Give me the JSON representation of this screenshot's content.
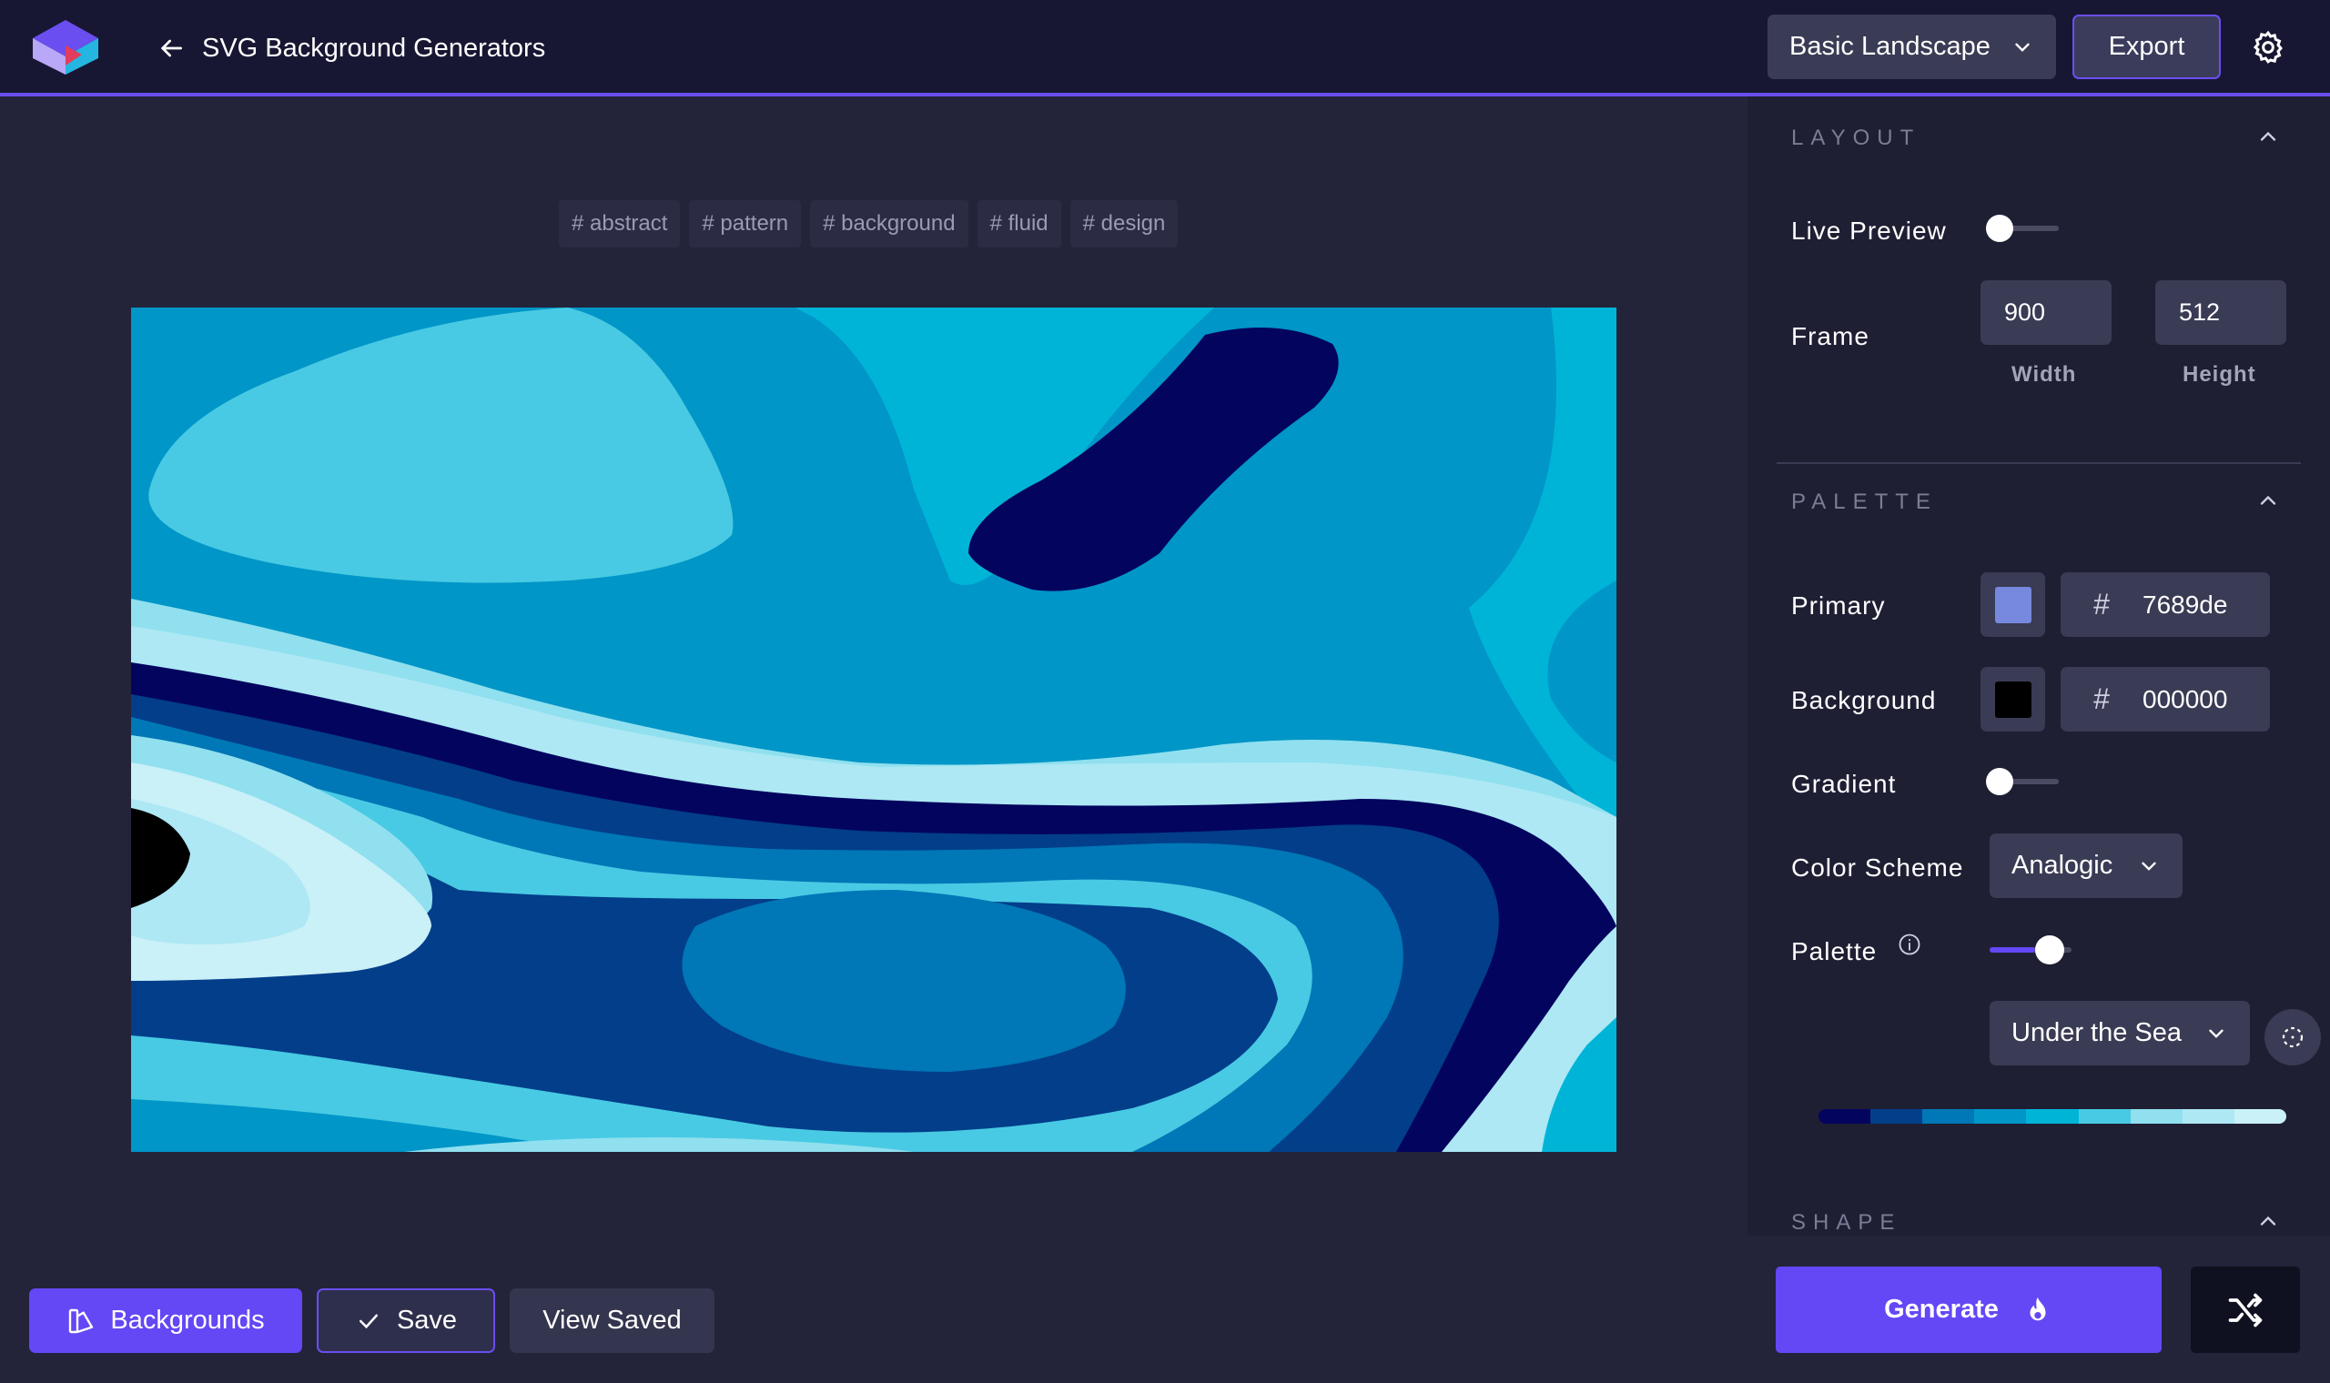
{
  "header": {
    "back_label": "SVG Background Generators",
    "preset": "Basic Landscape",
    "export_label": "Export"
  },
  "tags": [
    "# abstract",
    "# pattern",
    "# background",
    "# fluid",
    "# design"
  ],
  "bottom": {
    "backgrounds_label": "Backgrounds",
    "save_label": "Save",
    "view_saved_label": "View Saved"
  },
  "layout": {
    "title": "LAYOUT",
    "live_preview_label": "Live Preview",
    "live_preview_on": false,
    "frame_label": "Frame",
    "width": "900",
    "height": "512",
    "width_label": "Width",
    "height_label": "Height"
  },
  "palette": {
    "title": "PALETTE",
    "primary_label": "Primary",
    "primary_hex": "7689de",
    "primary_color": "#7689de",
    "background_label": "Background",
    "background_hex": "000000",
    "background_color": "#000000",
    "hash": "#",
    "gradient_label": "Gradient",
    "gradient_on": false,
    "color_scheme_label": "Color Scheme",
    "color_scheme": "Analogic",
    "palette_label": "Palette",
    "palette_slider_value": 0.55,
    "palette_name": "Under the Sea",
    "colors": [
      "#03045e",
      "#023e8a",
      "#0077b6",
      "#0096c7",
      "#00b4d8",
      "#48cae4",
      "#90e0ef",
      "#ade8f4",
      "#caf0f8"
    ]
  },
  "shape": {
    "title": "SHAPE"
  },
  "footer": {
    "generate_label": "Generate"
  },
  "theme": {
    "accent": "#6447f5",
    "topbar": "#171733",
    "panel": "#1e1f33",
    "canvas": "#23243a"
  }
}
